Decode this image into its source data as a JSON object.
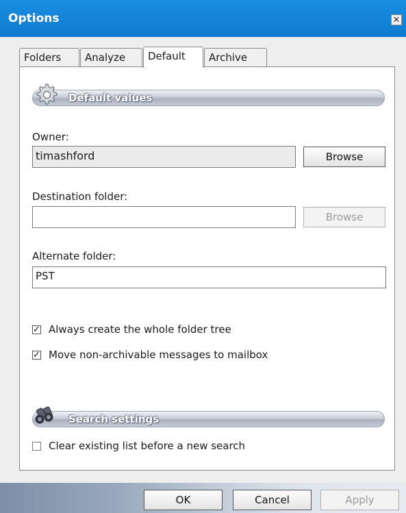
{
  "window": {
    "title": "Options"
  },
  "tabs": [
    {
      "label": "Folders",
      "active": false
    },
    {
      "label": "Analyze",
      "active": false
    },
    {
      "label": "Default",
      "active": true
    },
    {
      "label": "Archive",
      "active": false
    }
  ],
  "default_values": {
    "section_title": "Default values",
    "owner": {
      "label": "Owner:",
      "value": "timashford",
      "browse_label": "Browse"
    },
    "destination": {
      "label": "Destination folder:",
      "value": "",
      "browse_label": "Browse"
    },
    "alternate": {
      "label": "Alternate folder:",
      "value": "PST"
    },
    "checkboxes": [
      {
        "label": "Always create the whole folder tree",
        "checked": true
      },
      {
        "label": "Move non-archivable messages to mailbox",
        "checked": true
      }
    ]
  },
  "search_settings": {
    "section_title": "Search settings",
    "checkboxes": [
      {
        "label": "Clear existing list before a new search",
        "checked": false
      }
    ]
  },
  "footer": {
    "ok_label": "OK",
    "cancel_label": "Cancel",
    "apply_label": "Apply"
  },
  "colors": {
    "titlebar": "#1a8ee2",
    "panel": "#ffffff",
    "window_bg": "#eeeeee"
  },
  "icons": {
    "default_values": "gear-icon",
    "search_settings": "binoculars-icon",
    "close": "close-icon"
  }
}
